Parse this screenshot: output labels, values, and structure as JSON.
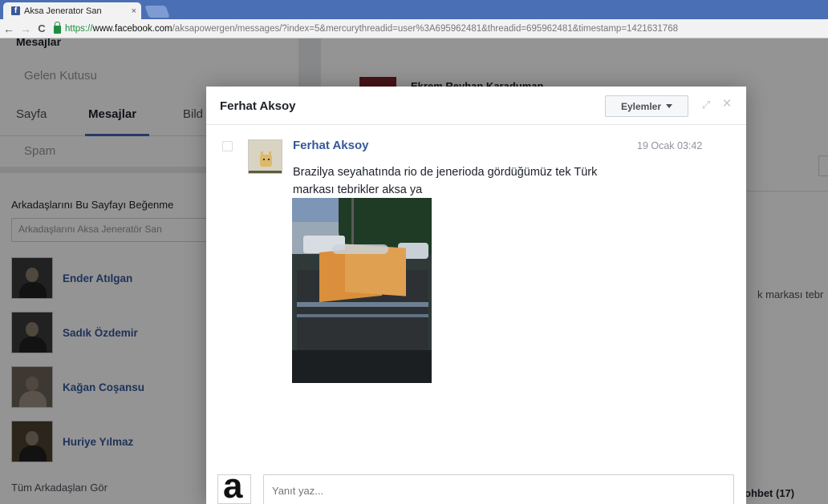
{
  "browser": {
    "tab_title": "Aksa Jenerator San",
    "tab_favicon_letter": "f",
    "tab_close": "×",
    "back_icon": "←",
    "forward_icon": "→",
    "reload_icon": "C",
    "url_scheme": "https://",
    "url_domain": "www.facebook.com",
    "url_path": "/aksapowergen/messages/?index=5&mercurythreadid=user%3A695962481&threadid=695962481&timestamp=1421631768"
  },
  "left_panel": {
    "section_title": "Mesajlar",
    "inbox_label": "Gelen Kutusu",
    "tabs": [
      {
        "label": "Sayfa"
      },
      {
        "label": "Mesajlar"
      },
      {
        "label": "Bild"
      }
    ],
    "spam_label": "Spam",
    "friends_title": "Arkadaşlarını Bu Sayfayı Beğenme",
    "friends_search_placeholder": "Arkadaşlarını Aksa Jeneratör San",
    "friends": [
      {
        "name": "Ender Atılgan"
      },
      {
        "name": "Sadık Özdemir"
      },
      {
        "name": "Kağan Coşansu"
      },
      {
        "name": "Huriye Yılmaz"
      }
    ],
    "see_all": "Tüm Arkadaşları Gör"
  },
  "center_panel": {
    "thread_name": "Ekrem Reyhan Karaduman",
    "preview_tail": "k markası tebr",
    "chat_label": "ohbet (17)"
  },
  "dialog": {
    "title": "Ferhat Aksoy",
    "actions_label": "Eylemler",
    "expand_icon": "⤢",
    "close_icon": "×",
    "message": {
      "sender": "Ferhat Aksoy",
      "time": "19 Ocak 03:42",
      "text": "Brazilya seyahatında rio de jenerioda gördüğümüz tek Türk markası tebrikler aksa ya"
    },
    "reply_placeholder": "Yanıt yaz..."
  },
  "colors": {
    "facebook_blue": "#4267b2",
    "link_blue": "#365899",
    "chrome_tab_strip": "#4a6fb4"
  }
}
